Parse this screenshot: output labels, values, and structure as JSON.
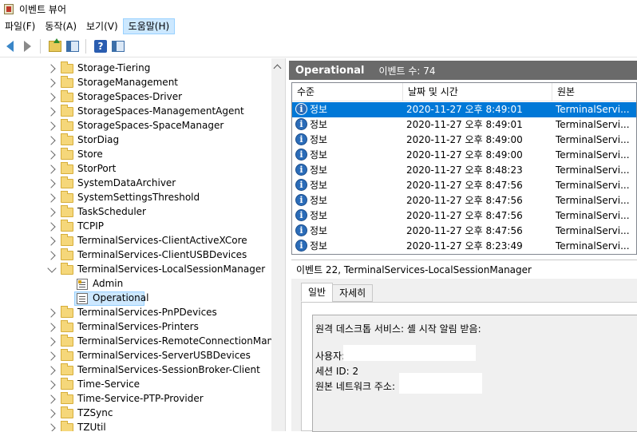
{
  "window": {
    "title": "이벤트 뷰어"
  },
  "menu": [
    "파일(F)",
    "동작(A)",
    "보기(V)",
    "도움말(H)"
  ],
  "tree": {
    "items": [
      {
        "label": "Storage-Tiering",
        "type": "folder",
        "expanded": false
      },
      {
        "label": "StorageManagement",
        "type": "folder",
        "expanded": false
      },
      {
        "label": "StorageSpaces-Driver",
        "type": "folder",
        "expanded": false
      },
      {
        "label": "StorageSpaces-ManagementAgent",
        "type": "folder",
        "expanded": false
      },
      {
        "label": "StorageSpaces-SpaceManager",
        "type": "folder",
        "expanded": false
      },
      {
        "label": "StorDiag",
        "type": "folder",
        "expanded": false
      },
      {
        "label": "Store",
        "type": "folder",
        "expanded": false
      },
      {
        "label": "StorPort",
        "type": "folder",
        "expanded": false
      },
      {
        "label": "SystemDataArchiver",
        "type": "folder",
        "expanded": false
      },
      {
        "label": "SystemSettingsThreshold",
        "type": "folder",
        "expanded": false
      },
      {
        "label": "TaskScheduler",
        "type": "folder",
        "expanded": false
      },
      {
        "label": "TCPIP",
        "type": "folder",
        "expanded": false
      },
      {
        "label": "TerminalServices-ClientActiveXCore",
        "type": "folder",
        "expanded": false
      },
      {
        "label": "TerminalServices-ClientUSBDevices",
        "type": "folder",
        "expanded": false
      },
      {
        "label": "TerminalServices-LocalSessionManager",
        "type": "folder",
        "expanded": true
      },
      {
        "label": "Admin",
        "type": "log-admin"
      },
      {
        "label": "Operational",
        "type": "log",
        "selected": true
      },
      {
        "label": "TerminalServices-PnPDevices",
        "type": "folder",
        "expanded": false
      },
      {
        "label": "TerminalServices-Printers",
        "type": "folder",
        "expanded": false
      },
      {
        "label": "TerminalServices-RemoteConnectionManager",
        "type": "folder",
        "expanded": false
      },
      {
        "label": "TerminalServices-ServerUSBDevices",
        "type": "folder",
        "expanded": false
      },
      {
        "label": "TerminalServices-SessionBroker-Client",
        "type": "folder",
        "expanded": false
      },
      {
        "label": "Time-Service",
        "type": "folder",
        "expanded": false
      },
      {
        "label": "Time-Service-PTP-Provider",
        "type": "folder",
        "expanded": false
      },
      {
        "label": "TZSync",
        "type": "folder",
        "expanded": false
      },
      {
        "label": "TZUtil",
        "type": "folder",
        "expanded": false
      }
    ]
  },
  "log_pane": {
    "title": "Operational",
    "count_label": "이벤트 수: 74",
    "columns": [
      "수준",
      "날짜 및 시간",
      "원본"
    ],
    "rows": [
      {
        "level": "정보",
        "datetime": "2020-11-27 오후 8:49:01",
        "source": "TerminalServi...",
        "selected": true
      },
      {
        "level": "정보",
        "datetime": "2020-11-27 오후 8:49:01",
        "source": "TerminalServi..."
      },
      {
        "level": "정보",
        "datetime": "2020-11-27 오후 8:49:00",
        "source": "TerminalServi..."
      },
      {
        "level": "정보",
        "datetime": "2020-11-27 오후 8:49:00",
        "source": "TerminalServi..."
      },
      {
        "level": "정보",
        "datetime": "2020-11-27 오후 8:48:23",
        "source": "TerminalServi..."
      },
      {
        "level": "정보",
        "datetime": "2020-11-27 오후 8:47:56",
        "source": "TerminalServi..."
      },
      {
        "level": "정보",
        "datetime": "2020-11-27 오후 8:47:56",
        "source": "TerminalServi..."
      },
      {
        "level": "정보",
        "datetime": "2020-11-27 오후 8:47:56",
        "source": "TerminalServi..."
      },
      {
        "level": "정보",
        "datetime": "2020-11-27 오후 8:47:56",
        "source": "TerminalServi..."
      },
      {
        "level": "정보",
        "datetime": "2020-11-27 오후 8:23:49",
        "source": "TerminalServi..."
      }
    ]
  },
  "detail": {
    "header": "이벤트 22, TerminalServices-LocalSessionManager",
    "tabs": [
      "일반",
      "자세히"
    ],
    "message": {
      "line1": "원격 데스크톱 서비스: 셸 시작 알림 받음:",
      "user_label": "사용자:",
      "session_label": "세션 ID: 2",
      "source_addr_label": "원본 네트워크 주소:"
    }
  }
}
